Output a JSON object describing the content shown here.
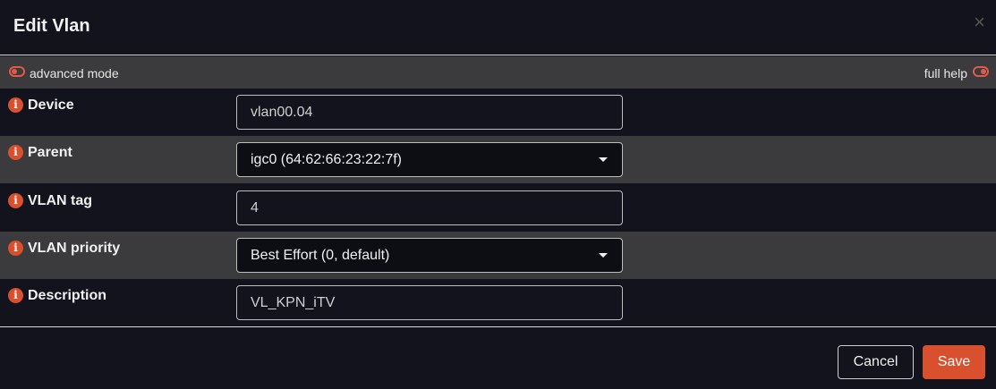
{
  "dialog": {
    "title": "Edit Vlan",
    "close_glyph": "×"
  },
  "modebar": {
    "advanced_label": "advanced mode",
    "full_help_label": "full help"
  },
  "fields": [
    {
      "label": "Device",
      "value": "vlan00.04",
      "kind": "input"
    },
    {
      "label": "Parent",
      "value": "igc0 (64:62:66:23:22:7f)",
      "kind": "select"
    },
    {
      "label": "VLAN tag",
      "value": "4",
      "kind": "input"
    },
    {
      "label": "VLAN priority",
      "value": "Best Effort (0, default)",
      "kind": "select"
    },
    {
      "label": "Description",
      "value": "VL_KPN_iTV",
      "kind": "input"
    }
  ],
  "icons": {
    "info": "info-icon",
    "info_glyph": "i",
    "caret": "chevron-down-icon",
    "toggle": "toggle-icon"
  },
  "footer": {
    "cancel_label": "Cancel",
    "save_label": "Save"
  },
  "colors": {
    "accent": "#d9502f",
    "background": "#12131c",
    "row_alt": "#3b3b3d"
  }
}
